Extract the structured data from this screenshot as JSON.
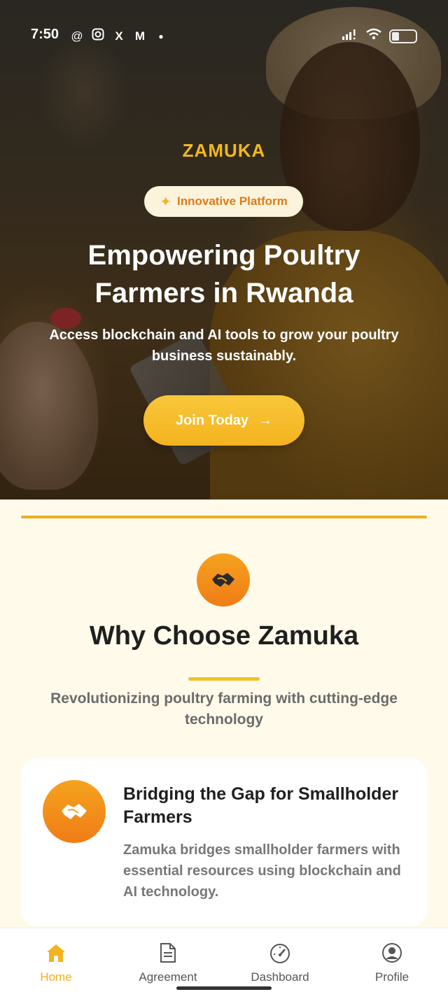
{
  "status_bar": {
    "time": "7:50",
    "left_icons": [
      "threads-icon",
      "instagram-icon",
      "x-icon",
      "gmail-icon",
      "dot-icon"
    ],
    "right_icons": [
      "signal-icon",
      "wifi-icon",
      "battery-icon"
    ]
  },
  "hero": {
    "logo": "ZAMUKA",
    "badge_icon": "✦",
    "badge_label": "Innovative Platform",
    "title_line1": "Empowering Poultry",
    "title_line2": "Farmers in Rwanda",
    "subtitle": "Access blockchain and AI tools to grow your poultry business sustainably.",
    "cta_label": "Join Today",
    "cta_arrow": "→"
  },
  "why_section": {
    "icon": "handshake-icon",
    "title": "Why Choose Zamuka",
    "subtitle": "Revolutionizing poultry farming with cutting-edge technology"
  },
  "feature_card": {
    "icon": "handshake-icon",
    "title": "Bridging the Gap for Smallholder Farmers",
    "description": "Zamuka bridges smallholder farmers with essential resources using blockchain and AI technology."
  },
  "bottom_nav": {
    "items": [
      {
        "label": "Home",
        "icon": "home-icon",
        "active": true
      },
      {
        "label": "Agreement",
        "icon": "document-icon",
        "active": false
      },
      {
        "label": "Dashboard",
        "icon": "speedometer-icon",
        "active": false
      },
      {
        "label": "Profile",
        "icon": "profile-icon",
        "active": false
      }
    ]
  },
  "colors": {
    "accent_yellow": "#f4b31f",
    "accent_orange": "#f07c16",
    "page_background": "#fffaea",
    "badge_text": "#e07a14"
  }
}
